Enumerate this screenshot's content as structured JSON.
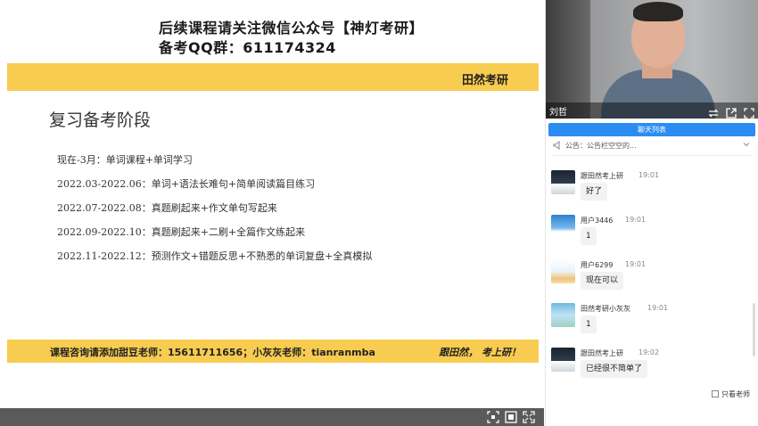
{
  "slide": {
    "promo_line1": "后续课程请关注微信公众号【神灯考研】",
    "promo_line2": "备考QQ群：611174324",
    "brand": "田然考研",
    "title": "复习备考阶段",
    "plan": [
      "现在-3月：单词课程+单词学习",
      "2022.03-2022.06：单词+语法长难句+简单阅读篇目练习",
      "2022.07-2022.08：真题刷起来+作文单句写起来",
      "2022.09-2022.10：真题刷起来+二刷+全篇作文练起来",
      "2022.11-2022.12：预测作文+错题反思+不熟悉的单词复盘+全真模拟"
    ],
    "contact": "课程咨询请添加甜豆老师：15611711656；小灰灰老师：tianranmba",
    "slogan": "跟田然， 考上研！"
  },
  "video": {
    "host_name": "刘哲"
  },
  "chat": {
    "tab_label": "聊天列表",
    "notice": "公告：公告栏空空的...",
    "messages": [
      {
        "user": "跟田然考上研",
        "time": "19:01",
        "text": "好了"
      },
      {
        "user": "用户3446",
        "time": "19:01",
        "text": "1"
      },
      {
        "user": "用户6299",
        "time": "19:01",
        "text": "现在可以"
      },
      {
        "user": "田然考研小灰灰",
        "time": "19:01",
        "text": "1"
      },
      {
        "user": "跟田然考上研",
        "time": "19:02",
        "text": "已经很不简单了"
      }
    ],
    "only_teacher_label": "只看老师"
  },
  "icons": {
    "controls": [
      "screenshot-icon",
      "fit-screen-icon",
      "fullscreen-icon"
    ],
    "video": [
      "switch-icon",
      "popout-icon",
      "expand-icon"
    ]
  },
  "colors": {
    "accent_yellow": "#f8cc50",
    "tab_blue": "#2b8cf2",
    "control_bar": "#5a5a5a"
  }
}
